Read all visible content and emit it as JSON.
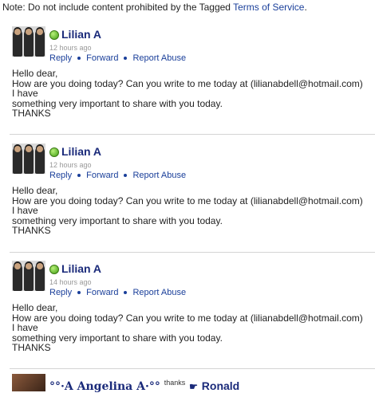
{
  "note": {
    "prefix": "Note: Do not include content prohibited by the Tagged ",
    "link": "Terms of Service",
    "suffix": "."
  },
  "actions": {
    "reply": "Reply",
    "forward": "Forward",
    "report": "Report Abuse"
  },
  "messages": [
    {
      "name": "Lilian A",
      "time": "12 hours ago",
      "body": "Hello dear,\nHow are you doing today? Can you write to me today at (lilianabdell@hotmail.com)\nI have\nsomething very important to share with you today.\nTHANKS"
    },
    {
      "name": "Lilian A",
      "time": "12 hours ago",
      "body": "Hello dear,\nHow are you doing today? Can you write to me today at (lilianabdell@hotmail.com)\nI have\nsomething very important to share with you today.\nTHANKS"
    },
    {
      "name": "Lilian A",
      "time": "14 hours ago",
      "body": "Hello dear,\nHow are you doing today? Can you write to me today at (lilianabdell@hotmail.com)\nI have\nsomething very important to share with you today.\nTHANKS"
    }
  ],
  "last": {
    "name_deco": "°°·A Angelina A·°°",
    "thanks": "thanks",
    "pointer_icon": "pointing-hand-icon",
    "pointer": "☛",
    "name": "Ronald"
  }
}
